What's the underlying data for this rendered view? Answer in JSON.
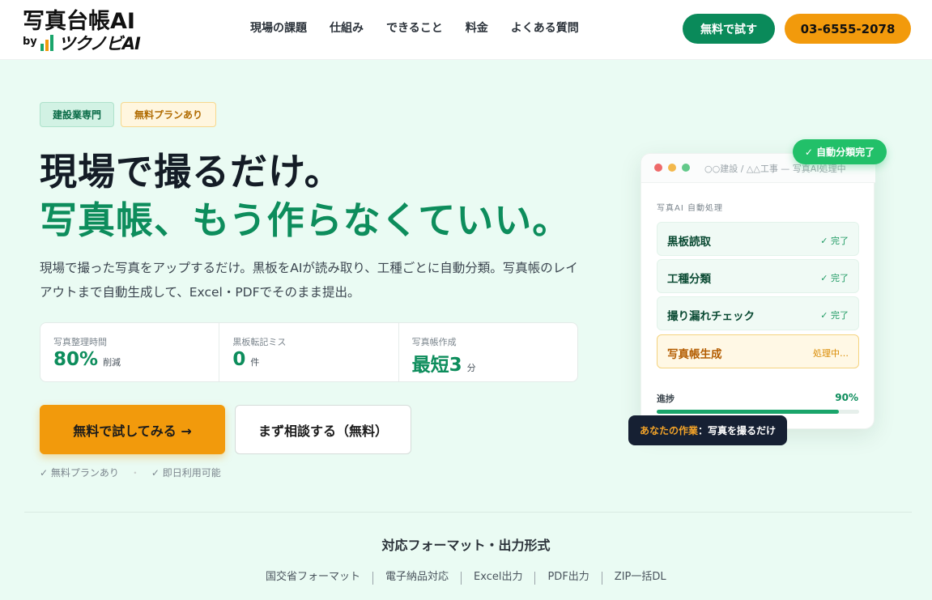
{
  "header": {
    "logo_main": "写真台帳AI",
    "logo_by": "by",
    "logo_sub": "ツクノビAI",
    "nav": [
      "現場の課題",
      "仕組み",
      "できること",
      "料金",
      "よくある質問"
    ],
    "cta_trial": "無料で試す",
    "phone": "03-6555-2078"
  },
  "hero": {
    "tags": [
      "建設業専門",
      "無料プランあり"
    ],
    "title_line1": "現場で撮るだけ。",
    "title_line2": "写真帳、もう作らなくていい。",
    "lead": "現場で撮った写真をアップするだけ。黒板をAIが読み取り、工種ごとに自動分類。写真帳のレイアウトまで自動生成して、Excel・PDFでそのまま提出。",
    "stats": [
      {
        "label": "写真整理時間",
        "value": "80%",
        "unit": "削減"
      },
      {
        "label": "黒板転記ミス",
        "value": "0",
        "unit": "件"
      },
      {
        "label": "写真帳作成",
        "value": "最短3",
        "unit": "分"
      }
    ],
    "cta_primary": "無料で試してみる →",
    "cta_secondary": "まず相談する（無料）",
    "notes": [
      "✓ 無料プランあり",
      "・",
      "✓ 即日利用可能"
    ]
  },
  "panel": {
    "path": "○○建設 / △△工事 — 写真AI処理中",
    "caption": "写真AI 自動処理",
    "steps": [
      {
        "name": "黒板読取",
        "status": "✓ 完了"
      },
      {
        "name": "工種分類",
        "status": "✓ 完了"
      },
      {
        "name": "撮り漏れチェック",
        "status": "✓ 完了"
      },
      {
        "name": "写真帳生成",
        "status": "処理中…"
      }
    ],
    "progress_label": "進捗",
    "progress_value": "90%",
    "progress_fraction": 0.9,
    "badge_done": "✓ 自動分類完了",
    "badge_you_prefix": "あなたの作業",
    "badge_you_text": "：写真を撮るだけ"
  },
  "formats": {
    "title": "対応フォーマット・出力形式",
    "items": [
      "国交省フォーマット",
      "電子納品対応",
      "Excel出力",
      "PDF出力",
      "ZIP一括DL"
    ]
  },
  "colors": {
    "brand_green": "#0a8a5a",
    "brand_orange": "#f29a0c",
    "hero_green": "#0d8d5c",
    "background": "#eafbf3"
  }
}
